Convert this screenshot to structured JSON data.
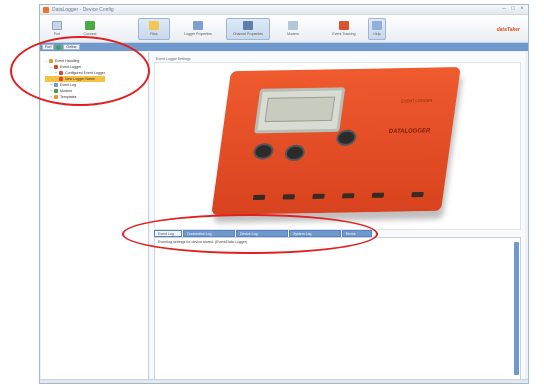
{
  "window": {
    "title": "DataLogger - Device Config",
    "controls": [
      "–",
      "□",
      "×"
    ]
  },
  "ribbon": {
    "buttons": [
      {
        "label": "Port",
        "icon": "port-icon",
        "active": false
      },
      {
        "label": "Connect",
        "icon": "connect-icon",
        "active": false
      },
      {
        "label": "Files",
        "icon": "files-icon",
        "active": true
      },
      {
        "label": "Logger Properties",
        "icon": "properties-icon",
        "active": false
      },
      {
        "label": "Channel Properties",
        "icon": "channel-icon",
        "active": false
      },
      {
        "label": "Modem",
        "icon": "modem-icon",
        "active": false
      },
      {
        "label": "Event Tracking",
        "icon": "event-icon",
        "active": false
      },
      {
        "label": "Help",
        "icon": "help-icon",
        "active": false
      }
    ],
    "brand": "dataTaker"
  },
  "connect_bar": {
    "chip1": "Port",
    "chip2": "Online"
  },
  "tree": {
    "nodes": [
      {
        "label": "Event Handling",
        "level": 0,
        "expander": "–",
        "icon_color": "#e09b2d",
        "selected": false
      },
      {
        "label": "Event Logger",
        "level": 1,
        "expander": "–",
        "icon_color": "#d24b2a",
        "selected": false
      },
      {
        "label": "Configured Event Logger",
        "level": 2,
        "expander": "+",
        "icon_color": "#d24b2a",
        "selected": false
      },
      {
        "label": "New Logger Name",
        "level": 2,
        "expander": "",
        "icon_color": "#d24b2a",
        "selected": true
      },
      {
        "label": "Event Log",
        "level": 1,
        "expander": "+",
        "icon_color": "#6f98cf",
        "selected": false
      },
      {
        "label": "Modem",
        "level": 1,
        "expander": "+",
        "icon_color": "#4a9a4a",
        "selected": false
      },
      {
        "label": "Templates",
        "level": 1,
        "expander": "+",
        "icon_color": "#e09b2d",
        "selected": false
      }
    ]
  },
  "preview": {
    "label": "Event Logger Settings",
    "device_text": "DATALOGGER",
    "device_text2": "EVENT LOGGER"
  },
  "log": {
    "tabs": [
      "Event Log",
      "Connection Log",
      "Device Log",
      "System Log",
      "Errors"
    ],
    "lines": [
      "Eventlog settings for device stored. (Event/Data Logger)"
    ]
  },
  "annotations": {
    "ring_color": "#e02020"
  }
}
